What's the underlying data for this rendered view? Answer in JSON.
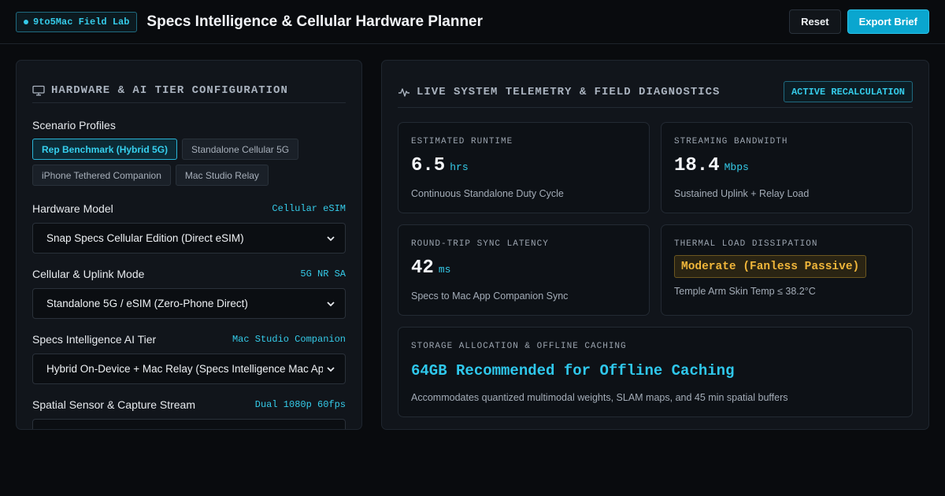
{
  "header": {
    "brand": "9to5Mac Field Lab",
    "title": "Specs Intelligence & Cellular Hardware Planner",
    "reset_label": "Reset",
    "export_label": "Export Brief"
  },
  "left_panel": {
    "title": "HARDWARE & AI TIER CONFIGURATION",
    "scenario_label": "Scenario Profiles",
    "scenarios": [
      {
        "label": "Rep Benchmark (Hybrid 5G)",
        "active": true
      },
      {
        "label": "Standalone Cellular 5G",
        "active": false
      },
      {
        "label": "iPhone Tethered Companion",
        "active": false
      },
      {
        "label": "Mac Studio Relay",
        "active": false
      }
    ],
    "fields": [
      {
        "label": "Hardware Model",
        "tag": "Cellular eSIM",
        "value": "Snap Specs Cellular Edition (Direct eSIM)"
      },
      {
        "label": "Cellular & Uplink Mode",
        "tag": "5G NR SA",
        "value": "Standalone 5G / eSIM (Zero-Phone Direct)"
      },
      {
        "label": "Specs Intelligence AI Tier",
        "tag": "Mac Studio Companion",
        "value": "Hybrid On-Device + Mac Relay (Specs Intelligence Mac App)"
      },
      {
        "label": "Spatial Sensor & Capture Stream",
        "tag": "Dual 1080p 60fps",
        "value": ""
      }
    ]
  },
  "right_panel": {
    "title": "LIVE SYSTEM TELEMETRY & FIELD DIAGNOSTICS",
    "status_badge": "ACTIVE RECALCULATION",
    "runtime": {
      "label": "ESTIMATED RUNTIME",
      "value": "6.5",
      "unit": "hrs",
      "desc": "Continuous Standalone Duty Cycle"
    },
    "bandwidth": {
      "label": "STREAMING BANDWIDTH",
      "value": "18.4",
      "unit": "Mbps",
      "desc": "Sustained Uplink + Relay Load"
    },
    "latency": {
      "label": "ROUND-TRIP SYNC LATENCY",
      "value": "42",
      "unit": "ms",
      "desc": "Specs to Mac App Companion Sync"
    },
    "thermal": {
      "label": "THERMAL LOAD DISSIPATION",
      "value": "Moderate (Fanless Passive)",
      "desc": "Temple Arm Skin Temp ≤ 38.2°C"
    },
    "storage": {
      "label": "STORAGE ALLOCATION & OFFLINE CACHING",
      "headline": "64GB Recommended for Offline Caching",
      "desc": "Accommodates quantized multimodal weights, SLAM maps, and 45 min spatial buffers"
    }
  },
  "colors": {
    "accent": "#35cbe9",
    "warning": "#f0b63a",
    "background": "#090b0e"
  },
  "icons": {
    "left_header": "monitor-icon",
    "right_header": "activity-pulse-icon",
    "select": "chevron-down-icon"
  }
}
